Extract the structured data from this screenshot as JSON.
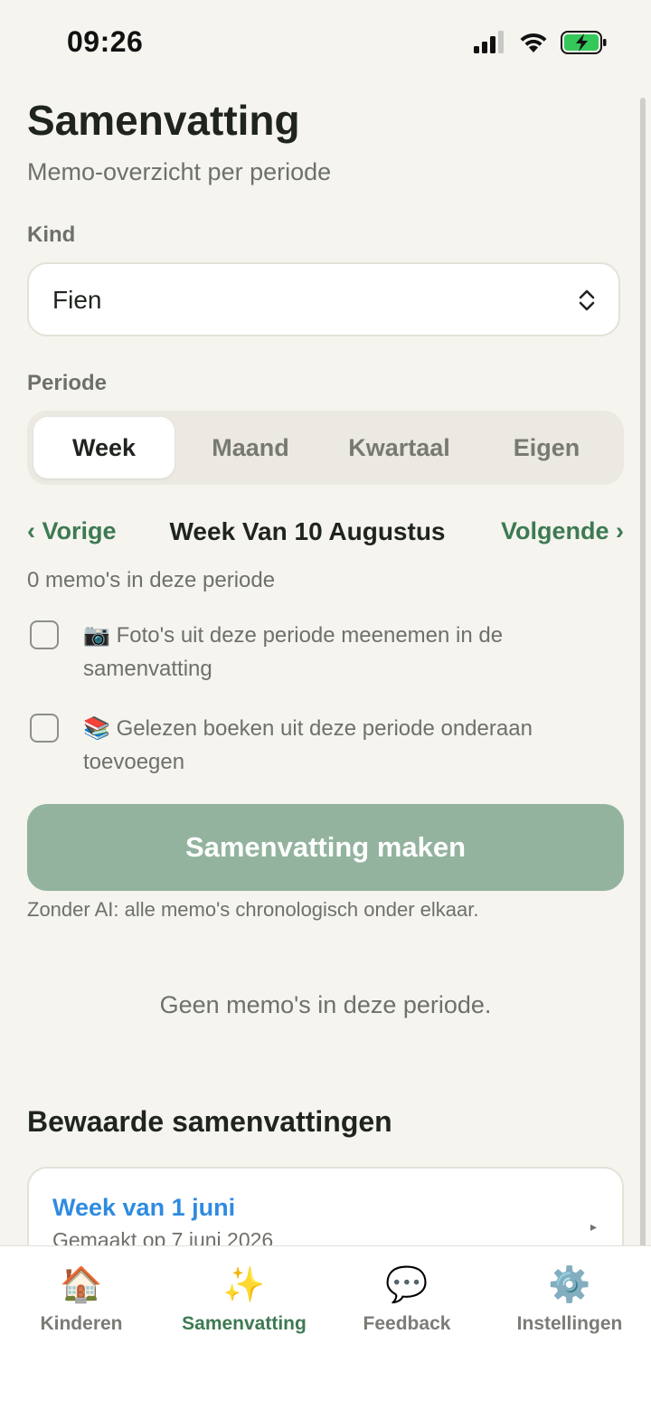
{
  "status_bar": {
    "time": "09:26"
  },
  "header": {
    "title": "Samenvatting",
    "subtitle": "Memo-overzicht per periode"
  },
  "kind": {
    "label": "Kind",
    "selected": "Fien"
  },
  "periode": {
    "label": "Periode",
    "segments": [
      "Week",
      "Maand",
      "Kwartaal",
      "Eigen"
    ],
    "active": "Week"
  },
  "period_nav": {
    "prev": "‹ Vorige",
    "title": "Week Van 10 Augustus",
    "next": "Volgende ›"
  },
  "memo_count": "0 memo's in deze periode",
  "options": [
    {
      "emoji": "📷",
      "text": "Foto's uit deze periode meenemen in de samenvatting",
      "checked": false
    },
    {
      "emoji": "📚",
      "text": "Gelezen boeken uit deze periode onderaan toevoegen",
      "checked": false
    }
  ],
  "primary_button": "Samenvatting maken",
  "hint": "Zonder AI: alle memo's chronologisch onder elkaar.",
  "empty_state": "Geen memo's in deze periode.",
  "saved": {
    "title": "Bewaarde samenvattingen",
    "items": [
      {
        "title": "Week van 1 juni",
        "subtitle": "Gemaakt op 7 juni 2026"
      }
    ]
  },
  "tabs": [
    {
      "icon": "🏠",
      "label": "Kinderen"
    },
    {
      "icon": "✨",
      "label": "Samenvatting"
    },
    {
      "icon": "💬",
      "label": "Feedback"
    },
    {
      "icon": "⚙️",
      "label": "Instellingen"
    }
  ],
  "colors": {
    "background": "#f5f4ef",
    "accent_green": "#3d7a52",
    "button_green": "#93b39e",
    "link_blue": "#2f8be0",
    "battery_green": "#34c759"
  }
}
